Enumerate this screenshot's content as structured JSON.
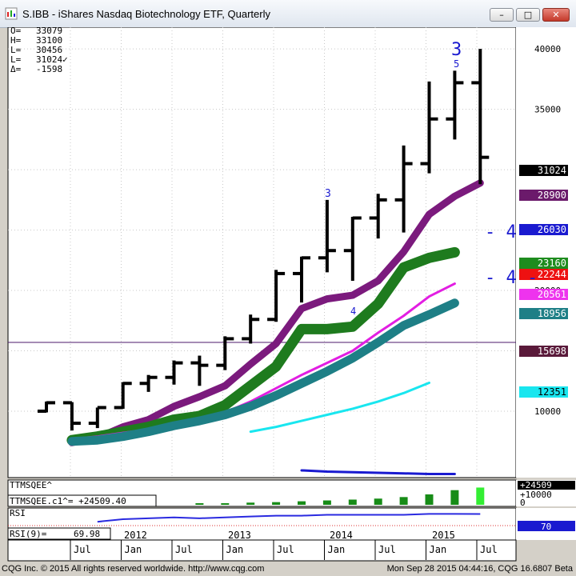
{
  "window": {
    "title": "S.IBB - iShares Nasdaq Biotechnology ETF, Quarterly",
    "minimize": "–",
    "maximize": "□",
    "close": "✕"
  },
  "ohlc_readout": [
    {
      "label": "O=",
      "value": "33079"
    },
    {
      "label": "H=",
      "value": "33100"
    },
    {
      "label": "L=",
      "value": "30456"
    },
    {
      "label": "L=",
      "value": "31024✓"
    },
    {
      "label": "Δ=",
      "value": "-1598"
    }
  ],
  "annotations": [
    {
      "text": "3",
      "size": "big"
    },
    {
      "text": "5",
      "size": "small"
    },
    {
      "text": "3",
      "size": "small"
    },
    {
      "text": "4",
      "size": "small"
    },
    {
      "text": "- 4 -",
      "size": "big"
    },
    {
      "text": "- 4 -",
      "size": "big"
    }
  ],
  "chart_data": {
    "type": "line",
    "title": "S.IBB - iShares Nasdaq Biotechnology ETF, Quarterly",
    "price_axis": {
      "range": [
        4500,
        41800
      ],
      "ticks": [
        10000,
        15000,
        20000,
        25000,
        30000,
        35000,
        40000
      ],
      "tick_labels": [
        "10000",
        "15000",
        "20000",
        "25000",
        "30000",
        "35000",
        "40000"
      ]
    },
    "time_axis": {
      "labels": [
        "Jul",
        "Jan",
        "Jul",
        "Jan",
        "Jul",
        "Jan",
        "Jul",
        "Jan",
        "Jul"
      ],
      "year_labels": [
        "2012",
        "2013",
        "2014",
        "2015"
      ]
    },
    "bars": [
      {
        "o": 10000,
        "h": 10800,
        "l": 9900,
        "c": 10700
      },
      {
        "o": 10700,
        "h": 10750,
        "l": 8400,
        "c": 9000
      },
      {
        "o": 9000,
        "h": 10300,
        "l": 8600,
        "c": 10300
      },
      {
        "o": 10300,
        "h": 12400,
        "l": 10200,
        "c": 12300
      },
      {
        "o": 12300,
        "h": 13000,
        "l": 11600,
        "c": 12800
      },
      {
        "o": 12800,
        "h": 14200,
        "l": 12200,
        "c": 14000
      },
      {
        "o": 14000,
        "h": 14600,
        "l": 12100,
        "c": 13800
      },
      {
        "o": 13800,
        "h": 16200,
        "l": 13400,
        "c": 16000
      },
      {
        "o": 16000,
        "h": 18000,
        "l": 15600,
        "c": 17600
      },
      {
        "o": 17600,
        "h": 21700,
        "l": 17400,
        "c": 21400
      },
      {
        "o": 21400,
        "h": 22800,
        "l": 19000,
        "c": 22700
      },
      {
        "o": 22700,
        "h": 27500,
        "l": 21500,
        "c": 23300
      },
      {
        "o": 23300,
        "h": 26100,
        "l": 20800,
        "c": 26000
      },
      {
        "o": 26000,
        "h": 28000,
        "l": 24300,
        "c": 27500
      },
      {
        "o": 27500,
        "h": 32000,
        "l": 24800,
        "c": 30500
      },
      {
        "o": 30500,
        "h": 37300,
        "l": 29700,
        "c": 34200
      },
      {
        "o": 34200,
        "h": 38200,
        "l": 32500,
        "c": 37200
      },
      {
        "o": 37200,
        "h": 40000,
        "l": 28800,
        "c": 31024
      }
    ],
    "series": [
      {
        "color": "#7b1a7d",
        "width": 9,
        "values": [
          null,
          7400,
          7800,
          8700,
          9300,
          10400,
          11200,
          12100,
          13900,
          15600,
          18500,
          19300,
          19600,
          20800,
          23200,
          26300,
          27800,
          28900
        ]
      },
      {
        "color": "#1e7b1e",
        "width": 13,
        "values": [
          null,
          7600,
          7900,
          8300,
          8700,
          9300,
          9600,
          10500,
          12100,
          13700,
          16800,
          16800,
          17000,
          18900,
          21900,
          22700,
          23160,
          null
        ]
      },
      {
        "color": "#e21ee2",
        "width": 3,
        "values": [
          null,
          7700,
          7900,
          8200,
          8500,
          9000,
          9400,
          9900,
          10800,
          11900,
          13000,
          14000,
          15000,
          16500,
          17900,
          19500,
          20561,
          null
        ]
      },
      {
        "color": "#1e7f86",
        "width": 11,
        "values": [
          null,
          7500,
          7600,
          7900,
          8300,
          8800,
          9200,
          9700,
          10400,
          11300,
          12300,
          13300,
          14400,
          15700,
          17100,
          18000,
          18956,
          null
        ]
      },
      {
        "color": "#19e6ef",
        "width": 3,
        "values": [
          null,
          null,
          null,
          null,
          null,
          null,
          null,
          null,
          8300,
          8700,
          9200,
          9700,
          10200,
          10800,
          11500,
          12351,
          null,
          null
        ]
      },
      {
        "color": "#1a1ad0",
        "width": 3,
        "values": [
          null,
          null,
          null,
          null,
          null,
          null,
          null,
          null,
          null,
          null,
          5100,
          5000,
          4950,
          4900,
          4850,
          4800,
          4800,
          null
        ]
      }
    ],
    "horizontal_line": {
      "value": 15698,
      "color": "#4b1a6b"
    },
    "price_tags": [
      {
        "value": "31024",
        "bg": "#000000",
        "fg": "#ffffff"
      },
      {
        "value": "28900",
        "bg": "#6b1a6b",
        "fg": "#ffffff"
      },
      {
        "value": "26030",
        "bg": "#1a1ad0",
        "fg": "#ffffff"
      },
      {
        "value": "23160",
        "bg": "#1e8c1e",
        "fg": "#ffffff"
      },
      {
        "value": "22244",
        "bg": "#ee1111",
        "fg": "#ffffff"
      },
      {
        "value": "20561",
        "bg": "#ee33ee",
        "fg": "#ffffff"
      },
      {
        "value": "18956",
        "bg": "#1e7f86",
        "fg": "#ffffff"
      },
      {
        "value": "15698",
        "bg": "#5a1a3a",
        "fg": "#ffffff"
      },
      {
        "value": "12351",
        "bg": "#19e6ef",
        "fg": "#000000"
      }
    ],
    "squeeze_panel": {
      "title": "TTMSQEE^",
      "readout": "TTMSQEE.c1^= +24509.40",
      "values": [
        0,
        0,
        0,
        0,
        0,
        0,
        1700,
        2200,
        3100,
        3800,
        5000,
        6200,
        7400,
        8800,
        11000,
        14800,
        20800,
        24509
      ],
      "last_tag": "+24509",
      "scale_label": "+10000",
      "zero_label": "0"
    },
    "rsi_panel": {
      "title": "RSI",
      "readout_label": "RSI(9)=",
      "readout_value": "69.98",
      "values": [
        null,
        null,
        61,
        64,
        65,
        66,
        65,
        66,
        67,
        68,
        68,
        69,
        69,
        69,
        69,
        70,
        70,
        69.98
      ],
      "tag": "70"
    }
  },
  "footer": {
    "left": "CQG Inc. © 2015 All rights reserved worldwide. http://www.cqg.com",
    "right": "Mon Sep 28 2015 04:44:16, CQG 16.6807 Beta"
  }
}
